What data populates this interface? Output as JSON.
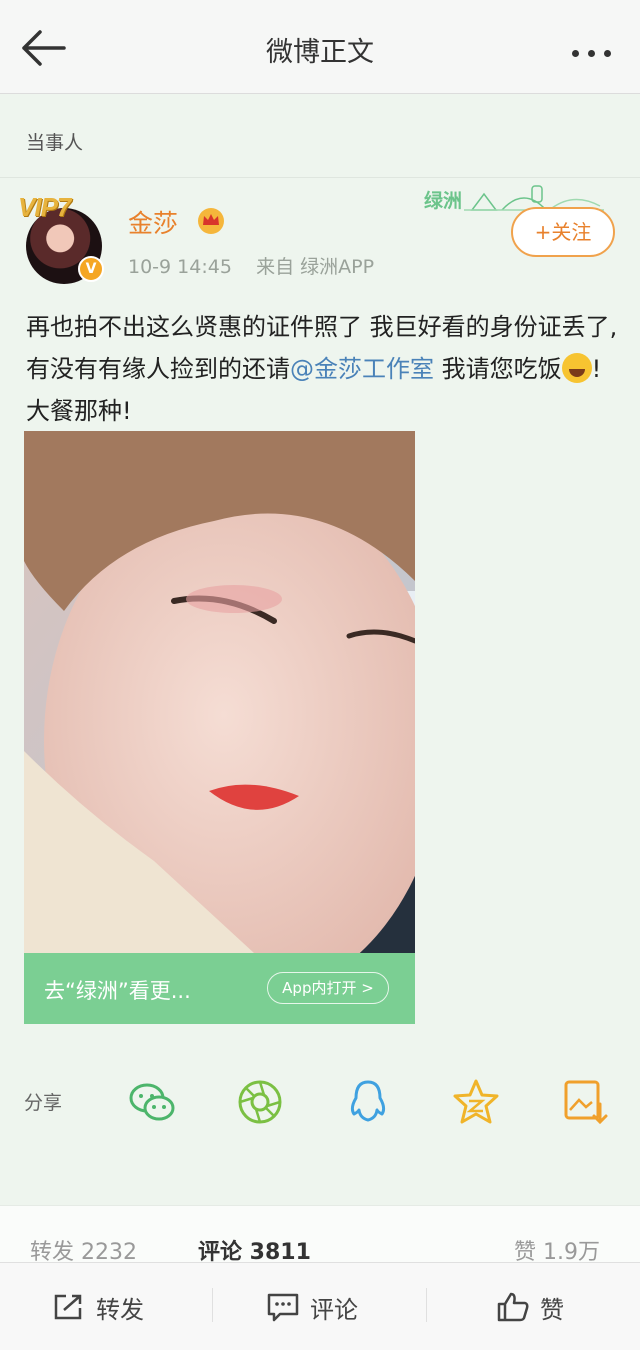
{
  "header": {
    "title": "微博正文"
  },
  "section": {
    "label": "当事人"
  },
  "author": {
    "name": "金莎",
    "vip_badge": "VIP7",
    "verified_mark": "V",
    "time": "10-9 14:45",
    "source": "来自 绿洲APP",
    "follow_label": "+关注"
  },
  "oasis_brand": {
    "text": "绿洲"
  },
  "post": {
    "text_before": "再也拍不出这么贤惠的证件照了 我巨好看的身份证丢了,有没有有缘人捡到的还请",
    "mention": "@金莎工作室",
    "text_middle": " 我请您吃饭",
    "text_after": "!大餐那种!"
  },
  "oasis_bar": {
    "text": "去“绿洲”看更...",
    "button": "App内打开 >"
  },
  "share": {
    "label": "分享",
    "targets": [
      "wechat-icon",
      "moments-icon",
      "qq-icon",
      "qzone-icon",
      "save-image-icon"
    ]
  },
  "stats": {
    "repost": "转发 2232",
    "comment": "评论 3811",
    "like": "赞 1.9万"
  },
  "bottom": {
    "repost": "转发",
    "comment": "评论",
    "like": "赞"
  },
  "colors": {
    "accent": "#e8812c",
    "oasis_green": "#7bcf93",
    "mention": "#4a82b8",
    "background": "#eef5ee"
  }
}
